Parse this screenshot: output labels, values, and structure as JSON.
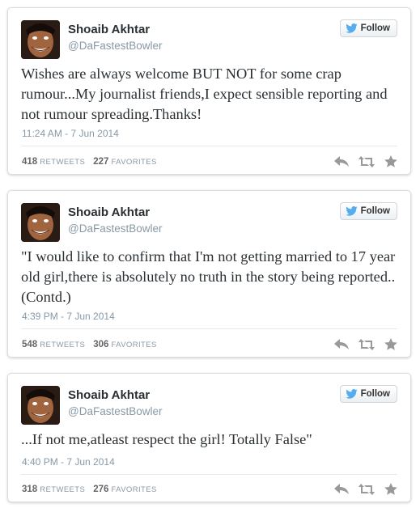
{
  "tweets": [
    {
      "name": "Shoaib Akhtar",
      "handle": "@DaFastestBowler",
      "follow_label": "Follow",
      "text": "Wishes are always welcome BUT NOT for some crap rumour...My journalist friends,I expect sensible reporting and not rumour spreading.Thanks!",
      "time": "11:24 AM - 7 Jun 2014",
      "retweets": "418",
      "retweets_label": "RETWEETS",
      "favorites": "227",
      "favorites_label": "FAVORITES"
    },
    {
      "name": "Shoaib Akhtar",
      "handle": "@DaFastestBowler",
      "follow_label": "Follow",
      "text": "\"I would like to confirm that I'm not getting married to 17 year old girl,there is absolutely no truth in the story being reported..(Contd.)",
      "time": "4:39 PM - 7 Jun 2014",
      "retweets": "548",
      "retweets_label": "RETWEETS",
      "favorites": "306",
      "favorites_label": "FAVORITES"
    },
    {
      "name": "Shoaib Akhtar",
      "handle": "@DaFastestBowler",
      "follow_label": "Follow",
      "text": "...If not me,atleast respect the girl! Totally False\"",
      "time": "4:40 PM - 7 Jun 2014",
      "retweets": "318",
      "retweets_label": "RETWEETS",
      "favorites": "276",
      "favorites_label": "FAVORITES"
    }
  ],
  "icons": {
    "avatar": "profile-photo",
    "follow": "twitter-bird-icon",
    "reply": "reply-icon",
    "retweet": "retweet-icon",
    "favorite": "star-icon"
  },
  "colors": {
    "twitter_blue": "#55acee",
    "action_gray": "#999999",
    "meta_gray": "#8899a6",
    "text": "#292f33"
  }
}
